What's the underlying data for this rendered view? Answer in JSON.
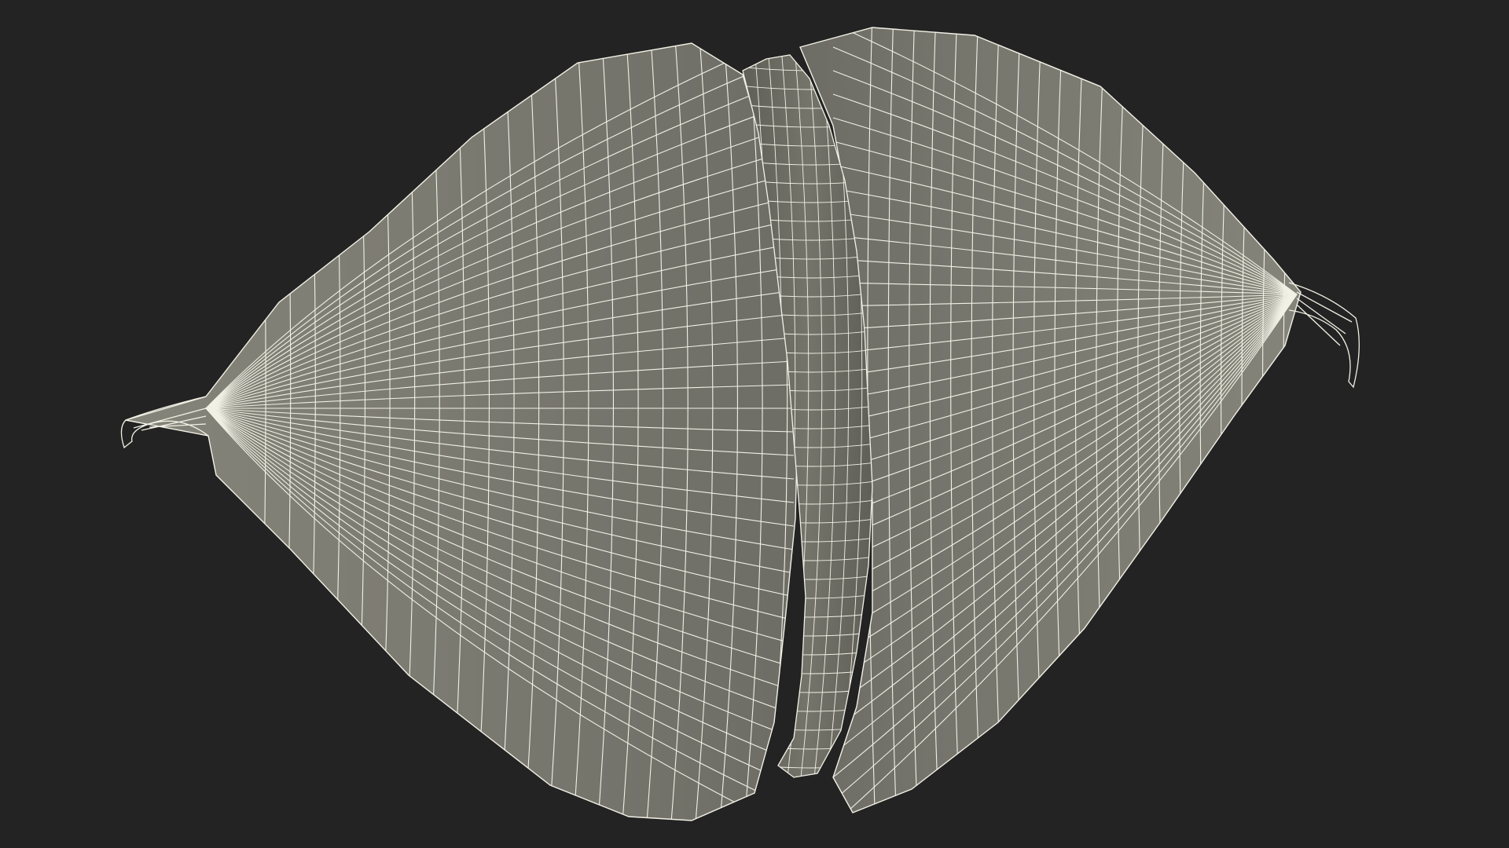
{
  "scene": {
    "background_color": "#232323",
    "surface_color": "#7b7a71",
    "surface_shade_color": "#6a6960",
    "wire_color": "#f2f1e6",
    "subject": "wireframe-mesh-render"
  }
}
